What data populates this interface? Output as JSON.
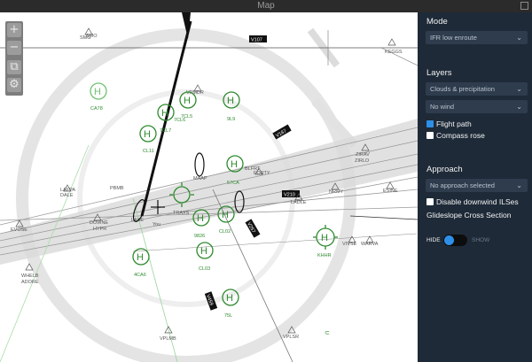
{
  "window": {
    "title": "Map"
  },
  "panel": {
    "mode_heading": "Mode",
    "mode_value": "IFR low enroute",
    "layers_heading": "Layers",
    "layer_weather": "Clouds & precipitation",
    "layer_wind": "No wind",
    "flight_path_label": "Flight path",
    "flight_path_checked": true,
    "compass_rose_label": "Compass rose",
    "compass_rose_checked": false,
    "approach_heading": "Approach",
    "approach_value": "No approach selected",
    "downwind_label": "Disable downwind ILSes",
    "downwind_checked": false,
    "glideslope_heading": "Glideslope Cross Section",
    "toggle_hide": "HIDE",
    "toggle_show": "SHOW"
  },
  "zoom_controls": {
    "zoom_in": "+",
    "zoom_out": "−"
  },
  "map": {
    "airway_labels": [
      "V107",
      "V210",
      "V187",
      "V257",
      "V459"
    ],
    "fixes": [
      "KEGGS",
      "SMO",
      "SMG",
      "VPMDR",
      "LAKE",
      "BLFRT",
      "FORTY",
      "ZIRAV",
      "ZIRLO",
      "ESINE",
      "NRMY",
      "LADLE",
      "VIVSE",
      "WARVA",
      "EVOSE",
      "WHELB",
      "ADORE",
      "DOWNE",
      "HYPR",
      "LAFPA",
      "DALE",
      "VPLMB",
      "VPLSR",
      "TRAXS",
      "MAAP",
      "PBMB"
    ],
    "heliports": [
      "CA78",
      "7CL5",
      "7CL6",
      "7CL7",
      "9L9",
      "CL11",
      "57CA",
      "CL02",
      "9826",
      "CL03",
      "4CA6",
      "75L",
      "KHHR"
    ],
    "you_label": "You"
  },
  "colors": {
    "panel_bg": "#1e2a38",
    "accent": "#2e8fe8",
    "heliport_green": "#2e8b2e",
    "airway_gray": "#8a8a8a"
  }
}
